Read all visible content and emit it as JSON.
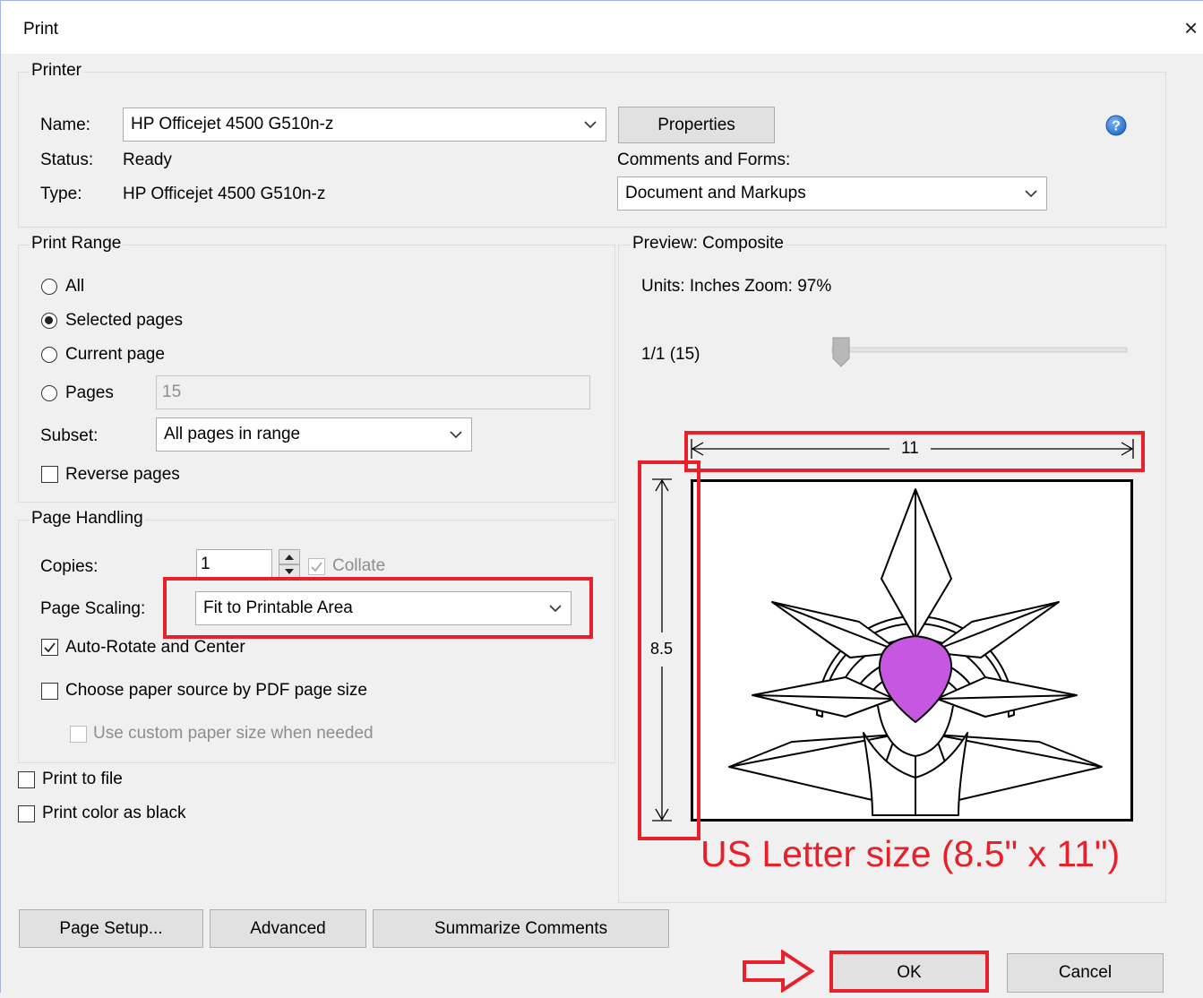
{
  "window": {
    "title": "Print",
    "close_glyph": "×"
  },
  "printer": {
    "legend": "Printer",
    "name_label": "Name:",
    "name_value": "HP Officejet 4500 G510n-z",
    "status_label": "Status:",
    "status_value": "Ready",
    "type_label": "Type:",
    "type_value": "HP Officejet 4500 G510n-z",
    "properties_label": "Properties",
    "help_glyph": "?",
    "comments_label": "Comments and Forms:",
    "comments_value": "Document and Markups"
  },
  "print_range": {
    "legend": "Print Range",
    "all_label": "All",
    "selected_label": "Selected pages",
    "current_label": "Current page",
    "pages_label": "Pages",
    "pages_value": "15",
    "selected_option": "Selected pages",
    "subset_label": "Subset:",
    "subset_value": "All pages in range",
    "reverse_label": "Reverse pages"
  },
  "page_handling": {
    "legend": "Page Handling",
    "copies_label": "Copies:",
    "copies_value": "1",
    "collate_label": "Collate",
    "scaling_label": "Page Scaling:",
    "scaling_value": "Fit to Printable Area",
    "autorotate_label": "Auto-Rotate and Center",
    "paper_source_label": "Choose paper source by PDF page size",
    "custom_paper_label": "Use custom paper size when needed"
  },
  "options": {
    "print_to_file_label": "Print to file",
    "color_black_label": "Print color as black"
  },
  "preview": {
    "legend": "Preview: Composite",
    "units_zoom": "Units: Inches Zoom:  97%",
    "page_counter": "1/1 (15)",
    "width_dim": "11",
    "height_dim": "8.5",
    "shape_fill": "#c657e0"
  },
  "annotation": {
    "caption": "US Letter size (8.5\" x 11\")",
    "color": "#e8202a"
  },
  "buttons": {
    "page_setup": "Page Setup...",
    "advanced": "Advanced",
    "summarize": "Summarize Comments",
    "ok": "OK",
    "cancel": "Cancel"
  }
}
